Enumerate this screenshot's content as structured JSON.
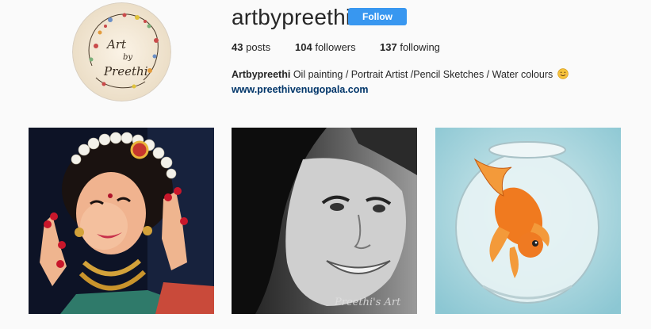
{
  "profile": {
    "username": "artbypreethi",
    "follow_label": "Follow",
    "stats": {
      "posts_count": "43",
      "posts_label": "posts",
      "followers_count": "104",
      "followers_label": "followers",
      "following_count": "137",
      "following_label": "following"
    },
    "bio": {
      "name": "Artbypreethi",
      "text": "Oil painting / Portrait Artist /Pencil Sketches / Water colours",
      "emoji": "smiling-face-emoji"
    },
    "website": "www.preethivenugopala.com",
    "avatar_logo": {
      "line1": "Art",
      "line2": "by",
      "line3": "Preethi"
    }
  },
  "posts": [
    {
      "subject": "bharatanatyam-dancer-painting",
      "watermark": ""
    },
    {
      "subject": "pencil-sketch-portrait",
      "watermark": "Preethi's Art"
    },
    {
      "subject": "goldfish-bowl-watercolour",
      "watermark": ""
    }
  ],
  "colors": {
    "follow_button": "#3897f0",
    "link": "#003569",
    "text": "#262626",
    "background": "#fafafa"
  }
}
